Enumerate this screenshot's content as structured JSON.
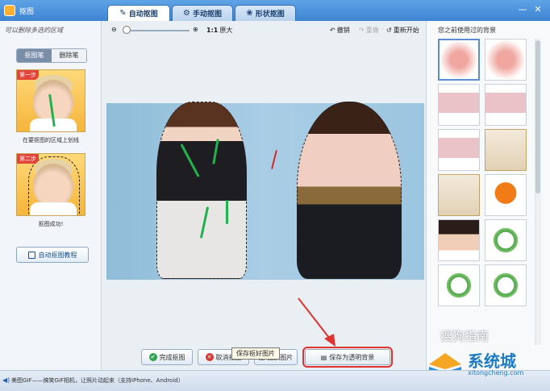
{
  "window": {
    "title": "抠图"
  },
  "tabs": [
    {
      "label": "自动抠图",
      "icon": "brush-icon"
    },
    {
      "label": "手动抠图",
      "icon": "gear-icon"
    },
    {
      "label": "形状抠图",
      "icon": "shape-icon"
    }
  ],
  "left": {
    "hint": "可以删除多选的区域",
    "modes": [
      "抠图笔",
      "删除笔"
    ],
    "step1_badge": "第一步",
    "step1_label": "在要抠图的区域上划线",
    "step2_badge": "第二步",
    "step2_label": "抠图成功!",
    "tutorial": "自动抠图教程"
  },
  "toolbar": {
    "ratio": "1:1",
    "original": "原大",
    "undo": "撤销",
    "redo": "重做",
    "restart": "重新开始"
  },
  "bottom": {
    "done": "完成抠图",
    "cancel": "取消抠图",
    "replace": "更换图片",
    "save": "保存为透明背景",
    "tooltip": "保存抠好图片"
  },
  "right": {
    "title": "您之前使用过的背景",
    "thumbs": [
      "pink",
      "pink",
      "photo",
      "photo",
      "photo",
      "cert",
      "cert",
      "bird",
      "face",
      "ring",
      "ring",
      "ring"
    ]
  },
  "status": {
    "text": "美图GIF——搞笑GIF相机，让照片动起来（支持iPhone、Android）"
  },
  "watermark": {
    "line1": "搜狗指南",
    "logo_text": "系统城",
    "url": "xitongcheng.com"
  },
  "colors": {
    "title_bar": "#4b92dc",
    "highlight": "#e0322f",
    "stroke": "#22b14c"
  }
}
